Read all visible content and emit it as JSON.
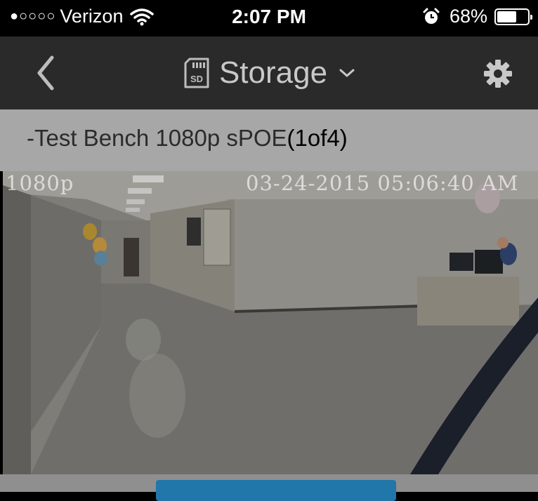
{
  "status_bar": {
    "signal_dots": "●○○○○",
    "carrier": "Verizon",
    "time": "2:07 PM",
    "battery_percent": "68%",
    "battery_level": 0.68,
    "icons": [
      "wifi-icon",
      "alarm-icon",
      "battery-icon"
    ]
  },
  "nav": {
    "title": "Storage",
    "icons": [
      "back-arrow-icon",
      "sd-card-icon",
      "chevron-down-icon",
      "gear-icon"
    ],
    "sd_label": "SD"
  },
  "camera": {
    "name": "-Test Bench 1080p sPOE",
    "count": "(1of4)"
  },
  "video": {
    "resolution_label": "1080p",
    "timestamp": "03-24-2015 05:06:40 AM"
  },
  "colors": {
    "nav_bg": "#2a2a2a",
    "header_bg": "#a7a7a7",
    "button_blue": "#2177a9"
  }
}
